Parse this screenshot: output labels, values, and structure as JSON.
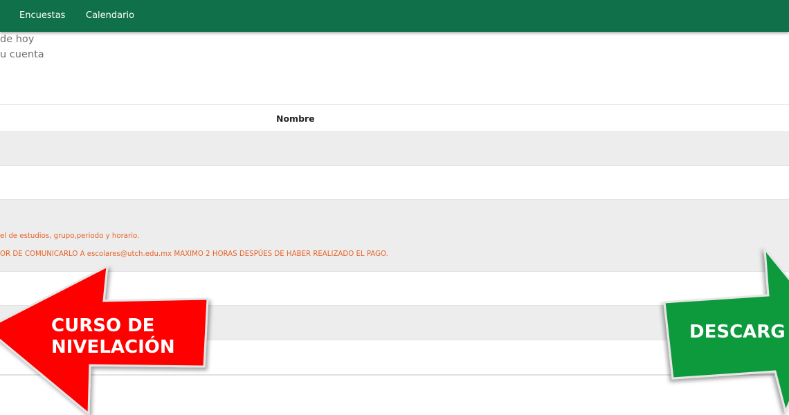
{
  "navbar": {
    "items": [
      {
        "label": "Encuestas"
      },
      {
        "label": "Calendario"
      }
    ],
    "color": "#107049"
  },
  "header_lines": [
    "de hoy",
    "u cuenta"
  ],
  "table": {
    "column_header": "Nombre",
    "notices": [
      "el de estudios, grupo,periodo y horario.",
      "OR DE COMUNICARLO A escolares@utch.edu.mx MAXIMO 2 HORAS DESPÚES DE HABER REALIZADO EL PAGO."
    ],
    "notice_color": "#e8632a"
  },
  "arrows": {
    "left": {
      "label_line1": "CURSO DE",
      "label_line2": "NIVELACIÓN",
      "color": "#ff0000"
    },
    "right": {
      "label": "DESCARG",
      "color": "#0c9a3c"
    }
  }
}
